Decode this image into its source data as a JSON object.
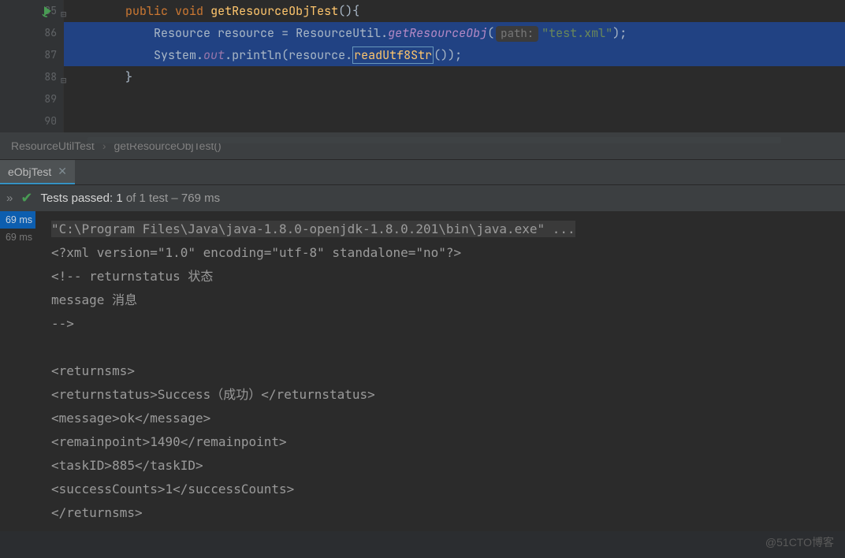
{
  "gutter": {
    "start": 85,
    "end": 90,
    "run_line": 85
  },
  "code": {
    "l85": {
      "kw1": "public",
      "kw2": "void",
      "method": "getResourceObjTest",
      "tail": "(){"
    },
    "l86": {
      "type1": "Resource",
      "var": "resource",
      "op": "=",
      "type2": "ResourceUtil",
      "call": "getResourceObj",
      "hint": "path:",
      "str": "\"test.xml\"",
      "tail": ");"
    },
    "l87": {
      "sys": "System",
      "out": "out",
      "println": "println",
      "var": "resource",
      "read": "readUtf8Str",
      "tail": "());"
    },
    "l88": "}"
  },
  "breadcrumbs": {
    "a": "ResourceUtilTest",
    "b": "getResourceObjTest()"
  },
  "tool_tab": {
    "label": "eObjTest"
  },
  "status": {
    "prefix": "Tests passed:",
    "passed": "1",
    "suffix": "of 1 test – 769 ms"
  },
  "tree": {
    "t1": "69 ms",
    "t2": "69 ms"
  },
  "console": {
    "cmd": "\"C:\\Program Files\\Java\\java-1.8.0-openjdk-1.8.0.201\\bin\\java.exe\" ...",
    "lines": [
      "<?xml version=\"1.0\" encoding=\"utf-8\" standalone=\"no\"?>",
      "<!-- returnstatus 状态",
      "     message 消息",
      "-->",
      "",
      "<returnsms>",
      "<returnstatus>Success（成功）</returnstatus>",
      "<message>ok</message>",
      "<remainpoint>1490</remainpoint>",
      "<taskID>885</taskID>",
      "<successCounts>1</successCounts>",
      "</returnsms>"
    ]
  },
  "watermark": "@51CTO博客"
}
